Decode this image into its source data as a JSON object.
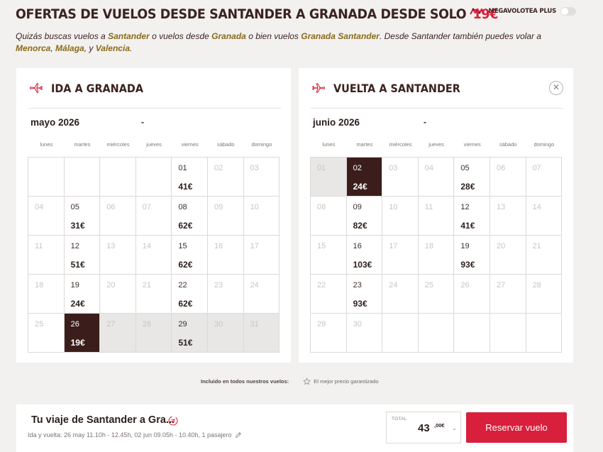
{
  "header": {
    "title": "OFERTAS DE VUELOS DESDE SANTANDER A GRANADA DESDE SOLO",
    "title_price": "19€",
    "megavolotea_label": "MEGAVOLOTEA PLUS",
    "megavolotea_toggle_on": false
  },
  "intro": {
    "t1": "Quizás buscas vuelos a ",
    "link1": "Santander",
    "t2": " o vuelos desde ",
    "link2": "Granada",
    "t3": " o bien vuelos ",
    "link3": "Granada Santander",
    "t4": ". Desde Santander también puedes volar a ",
    "link4": "Menorca",
    "t5": ", ",
    "link5": "Málaga",
    "t6": ", y ",
    "link6": "Valencia",
    "t7": "."
  },
  "weekdays": [
    "lunes",
    "martes",
    "miércoles",
    "jueves",
    "viernes",
    "sábado",
    "domingo"
  ],
  "outbound": {
    "title": "IDA A GRANADA",
    "month_label": "mayo 2026",
    "month_caret": "-",
    "cells": [
      {
        "day": "",
        "price": "",
        "state": "empty"
      },
      {
        "day": "",
        "price": "",
        "state": "empty"
      },
      {
        "day": "",
        "price": "",
        "state": "empty"
      },
      {
        "day": "",
        "price": "",
        "state": "empty"
      },
      {
        "day": "01",
        "price": "41€",
        "state": "available"
      },
      {
        "day": "02",
        "price": "",
        "state": "disabled"
      },
      {
        "day": "03",
        "price": "",
        "state": "disabled"
      },
      {
        "day": "04",
        "price": "",
        "state": "disabled"
      },
      {
        "day": "05",
        "price": "31€",
        "state": "available"
      },
      {
        "day": "06",
        "price": "",
        "state": "disabled"
      },
      {
        "day": "07",
        "price": "",
        "state": "disabled"
      },
      {
        "day": "08",
        "price": "62€",
        "state": "available"
      },
      {
        "day": "09",
        "price": "",
        "state": "disabled"
      },
      {
        "day": "10",
        "price": "",
        "state": "disabled"
      },
      {
        "day": "11",
        "price": "",
        "state": "disabled"
      },
      {
        "day": "12",
        "price": "51€",
        "state": "available"
      },
      {
        "day": "13",
        "price": "",
        "state": "disabled"
      },
      {
        "day": "14",
        "price": "",
        "state": "disabled"
      },
      {
        "day": "15",
        "price": "62€",
        "state": "available"
      },
      {
        "day": "16",
        "price": "",
        "state": "disabled"
      },
      {
        "day": "17",
        "price": "",
        "state": "disabled"
      },
      {
        "day": "18",
        "price": "",
        "state": "disabled"
      },
      {
        "day": "19",
        "price": "24€",
        "state": "available"
      },
      {
        "day": "20",
        "price": "",
        "state": "disabled"
      },
      {
        "day": "21",
        "price": "",
        "state": "disabled"
      },
      {
        "day": "22",
        "price": "62€",
        "state": "available"
      },
      {
        "day": "23",
        "price": "",
        "state": "disabled"
      },
      {
        "day": "24",
        "price": "",
        "state": "disabled"
      },
      {
        "day": "25",
        "price": "",
        "state": "disabled"
      },
      {
        "day": "26",
        "price": "19€",
        "state": "selected"
      },
      {
        "day": "27",
        "price": "",
        "state": "shaded"
      },
      {
        "day": "28",
        "price": "",
        "state": "shaded"
      },
      {
        "day": "29",
        "price": "51€",
        "state": "shaded-available"
      },
      {
        "day": "30",
        "price": "",
        "state": "shaded"
      },
      {
        "day": "31",
        "price": "",
        "state": "shaded"
      }
    ]
  },
  "return": {
    "title": "VUELTA A SANTANDER",
    "close_symbol": "✕",
    "month_label": "junio 2026",
    "month_caret": "-",
    "cells": [
      {
        "day": "01",
        "price": "",
        "state": "shaded"
      },
      {
        "day": "02",
        "price": "24€",
        "state": "selected"
      },
      {
        "day": "03",
        "price": "",
        "state": "disabled"
      },
      {
        "day": "04",
        "price": "",
        "state": "disabled"
      },
      {
        "day": "05",
        "price": "28€",
        "state": "available"
      },
      {
        "day": "06",
        "price": "",
        "state": "disabled"
      },
      {
        "day": "07",
        "price": "",
        "state": "disabled"
      },
      {
        "day": "08",
        "price": "",
        "state": "disabled"
      },
      {
        "day": "09",
        "price": "82€",
        "state": "available"
      },
      {
        "day": "10",
        "price": "",
        "state": "disabled"
      },
      {
        "day": "11",
        "price": "",
        "state": "disabled"
      },
      {
        "day": "12",
        "price": "41€",
        "state": "available"
      },
      {
        "day": "13",
        "price": "",
        "state": "disabled"
      },
      {
        "day": "14",
        "price": "",
        "state": "disabled"
      },
      {
        "day": "15",
        "price": "",
        "state": "disabled"
      },
      {
        "day": "16",
        "price": "103€",
        "state": "available"
      },
      {
        "day": "17",
        "price": "",
        "state": "disabled"
      },
      {
        "day": "18",
        "price": "",
        "state": "disabled"
      },
      {
        "day": "19",
        "price": "93€",
        "state": "available"
      },
      {
        "day": "20",
        "price": "",
        "state": "disabled"
      },
      {
        "day": "21",
        "price": "",
        "state": "disabled"
      },
      {
        "day": "22",
        "price": "",
        "state": "disabled"
      },
      {
        "day": "23",
        "price": "93€",
        "state": "available"
      },
      {
        "day": "24",
        "price": "",
        "state": "disabled"
      },
      {
        "day": "25",
        "price": "",
        "state": "disabled"
      },
      {
        "day": "26",
        "price": "",
        "state": "disabled"
      },
      {
        "day": "27",
        "price": "",
        "state": "disabled"
      },
      {
        "day": "28",
        "price": "",
        "state": "disabled"
      },
      {
        "day": "29",
        "price": "",
        "state": "disabled"
      },
      {
        "day": "30",
        "price": "",
        "state": "disabled"
      },
      {
        "day": "",
        "price": "",
        "state": "empty"
      },
      {
        "day": "",
        "price": "",
        "state": "empty"
      },
      {
        "day": "",
        "price": "",
        "state": "empty"
      },
      {
        "day": "",
        "price": "",
        "state": "empty"
      },
      {
        "day": "",
        "price": "",
        "state": "empty"
      }
    ]
  },
  "guarantee": {
    "label": "Incluido en todos nuestros vuelos:",
    "item": "El mejor precio garantizado"
  },
  "footer": {
    "trip_title": "Tu viaje de Santander a Gra...",
    "trip_details": "Ida y vuelta: 26 may 11.10h - 12.45h, 02 jun 09.05h - 10.40h, 1 pasajero",
    "total_label": "TOTAL",
    "total_amount": "43",
    "total_cents": ",00€",
    "total_caret": "⌄",
    "book_label": "Reservar vuelo"
  },
  "colors": {
    "accent_red": "#d81f3b",
    "selected_brown": "#3b1e1c",
    "link_gold": "#8a6a17"
  },
  "icons": {
    "plane": "plane-icon",
    "close": "close-icon",
    "star": "star-icon",
    "swap": "swap-icon",
    "pencil": "pencil-icon",
    "megavolotea_logo": "megavolotea-logo"
  }
}
